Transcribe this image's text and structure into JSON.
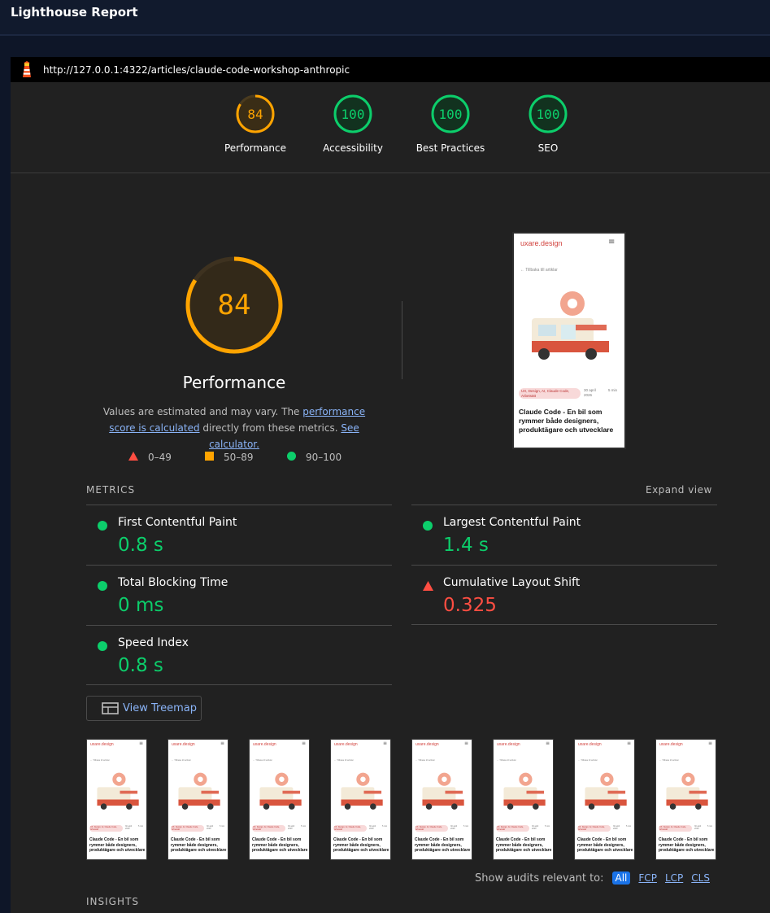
{
  "app": {
    "title": "Lighthouse Report"
  },
  "url": "http://127.0.0.1:4322/articles/claude-code-workshop-anthropic",
  "categories": [
    {
      "name": "Performance",
      "score": "84",
      "color": "#ffa400",
      "fraction": 0.84
    },
    {
      "name": "Accessibility",
      "score": "100",
      "color": "#0cce6b",
      "fraction": 1.0
    },
    {
      "name": "Best Practices",
      "score": "100",
      "color": "#0cce6b",
      "fraction": 1.0
    },
    {
      "name": "SEO",
      "score": "100",
      "color": "#0cce6b",
      "fraction": 1.0
    }
  ],
  "performance": {
    "score": "84",
    "fraction": 0.84,
    "title": "Performance",
    "desc_pre": "Values are estimated and may vary. The ",
    "desc_link1": "performance score is calculated",
    "desc_mid": " directly from these metrics. ",
    "desc_link2": "See calculator."
  },
  "legend": [
    {
      "range": "0–49",
      "shape": "triangle",
      "color": "#ff4e42"
    },
    {
      "range": "50–89",
      "shape": "square",
      "color": "#ffa400"
    },
    {
      "range": "90–100",
      "shape": "circle",
      "color": "#0cce6b"
    }
  ],
  "screenshot": {
    "brand": "uxare.design",
    "back": "← Tillbaka till artiklar",
    "tags": "UX, Design, AI, Claude Code, Arbetsätt",
    "date": "30 april 2026",
    "read": "5 min",
    "title": "Claude Code - En bil som rymmer både designers, produktägare och utvecklare"
  },
  "metrics_section": {
    "heading": "METRICS",
    "expand": "Expand view"
  },
  "metrics": [
    {
      "name": "First Contentful Paint",
      "value": "0.8 s",
      "status": "good"
    },
    {
      "name": "Largest Contentful Paint",
      "value": "1.4 s",
      "status": "good"
    },
    {
      "name": "Total Blocking Time",
      "value": "0 ms",
      "status": "good"
    },
    {
      "name": "Cumulative Layout Shift",
      "value": "0.325",
      "status": "bad"
    },
    {
      "name": "Speed Index",
      "value": "0.8 s",
      "status": "good"
    }
  ],
  "treemap": {
    "label": "View Treemap"
  },
  "filmstrip_count": 8,
  "filter": {
    "label": "Show audits relevant to:",
    "options": [
      "All",
      "FCP",
      "LCP",
      "CLS"
    ],
    "active": "All"
  },
  "insights": {
    "heading": "INSIGHTS"
  }
}
